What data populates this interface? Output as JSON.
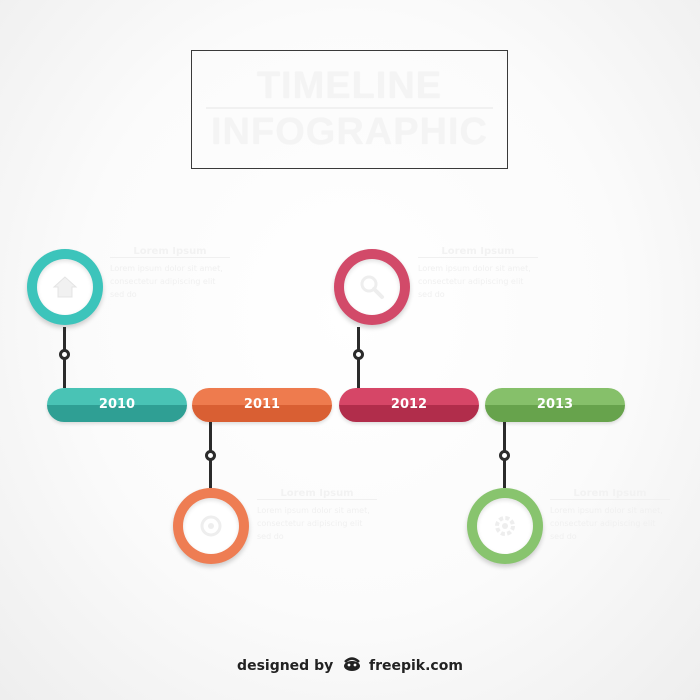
{
  "title": {
    "line1": "TIMELINE",
    "line2": "INFOGRAPHIC"
  },
  "milestones": [
    {
      "year": "2010",
      "color_top": "#49c3b5",
      "color_bottom": "#2f9f94",
      "ring_color": "#3cc4bb",
      "icon": "house-icon",
      "heading": "Lorem Ipsum",
      "body": "Lorem ipsum dolor sit amet, consectetur adipiscing elit sed do"
    },
    {
      "year": "2011",
      "color_top": "#ee7b4e",
      "color_bottom": "#d95f33",
      "ring_color": "#ee7d53",
      "icon": "circle-icon",
      "heading": "Lorem Ipsum",
      "body": "Lorem ipsum dolor sit amet, consectetur adipiscing elit sed do"
    },
    {
      "year": "2012",
      "color_top": "#d64667",
      "color_bottom": "#b12d4b",
      "ring_color": "#d24a69",
      "icon": "magnifier-icon",
      "heading": "Lorem Ipsum",
      "body": "Lorem ipsum dolor sit amet, consectetur adipiscing elit sed do"
    },
    {
      "year": "2013",
      "color_top": "#86c06a",
      "color_bottom": "#67a34c",
      "ring_color": "#88c46e",
      "icon": "gear-icon",
      "heading": "Lorem Ipsum",
      "body": "Lorem ipsum dolor sit amet, consectetur adipiscing elit sed do"
    }
  ],
  "footer": {
    "prefix": "designed by",
    "brand": "freepik.com",
    "icon": "freepik-logo-icon"
  }
}
